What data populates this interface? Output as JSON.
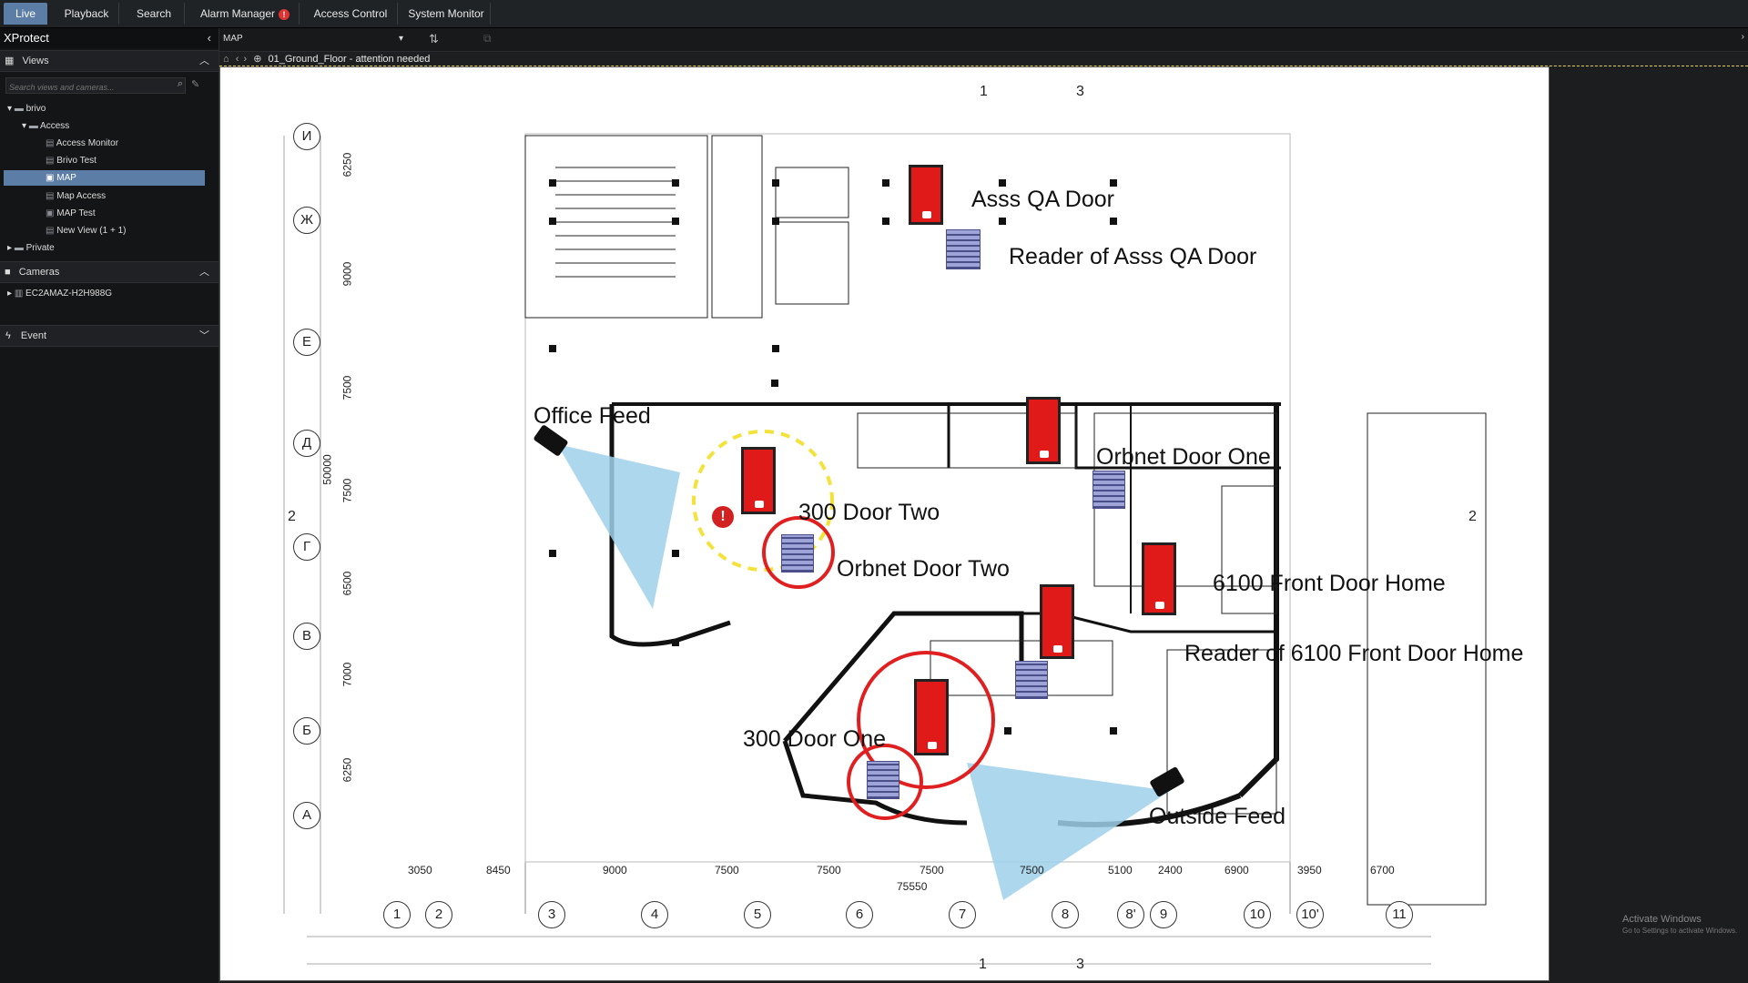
{
  "tabs": [
    {
      "label": "Live",
      "active": true
    },
    {
      "label": "Playback"
    },
    {
      "label": "Search"
    },
    {
      "label": "Alarm Manager",
      "badge": "!"
    },
    {
      "label": "Access Control"
    },
    {
      "label": "System Monitor"
    }
  ],
  "app": {
    "title": "XProtect"
  },
  "views": {
    "header": "Views",
    "search_placeholder": "Search views and cameras...",
    "tree": {
      "root": "brivo",
      "group": "Access",
      "items": [
        "Access Monitor",
        "Brivo Test",
        "MAP",
        "Map Access",
        "MAP Test",
        "New View (1 + 1)"
      ],
      "private": "Private"
    }
  },
  "cameras": {
    "header": "Cameras",
    "items": [
      "EC2AMAZ-H2H988G"
    ]
  },
  "event": {
    "header": "Event"
  },
  "toolbar": {
    "view_select": "MAP"
  },
  "breadcrumb": {
    "path": "01_Ground_Floor - attention needed"
  },
  "map": {
    "labels": {
      "asss_qa_door": "Asss QA Door",
      "reader_asss_qa": "Reader of Asss QA Door",
      "office_feed": "Office Feed",
      "orbnet_door_one": "Orbnet Door One",
      "door_300_two": "300 Door Two",
      "orbnet_door_two": "Orbnet Door Two",
      "front_door_6100": "6100 Front Door Home",
      "reader_6100": "Reader of 6100 Front Door Home",
      "door_300_one": "300 Door One",
      "outside_feed": "Outside Feed"
    },
    "row_axis": [
      "И",
      "Ж",
      "Е",
      "Д",
      "Г",
      "В",
      "Б",
      "А"
    ],
    "col_axis": [
      "1",
      "2",
      "3",
      "4",
      "5",
      "6",
      "7",
      "8",
      "8'",
      "9",
      "10",
      "10'",
      "11"
    ],
    "row_dims": [
      "6250",
      "9000",
      "7500",
      "7500",
      "6500",
      "7000",
      "6250"
    ],
    "total_left": "50000",
    "bottom_dims": [
      "3050",
      "8450",
      "9000",
      "7500",
      "7500",
      "7500",
      "7500",
      "5100",
      "2400",
      "6900",
      "3950",
      "6700"
    ],
    "total_bottom": "75550",
    "section_marks": {
      "top": [
        "1",
        "3"
      ],
      "bottom": [
        "1",
        "3"
      ],
      "side": "2"
    },
    "colors": {
      "door": "#e01919",
      "camera_cone": "#9fd0ea",
      "alert_circle": "#e02020",
      "attention_ring": "#f3e23a",
      "reader": "#7d84c8"
    }
  },
  "watermark": {
    "line1": "Activate Windows",
    "line2": "Go to Settings to activate Windows."
  }
}
